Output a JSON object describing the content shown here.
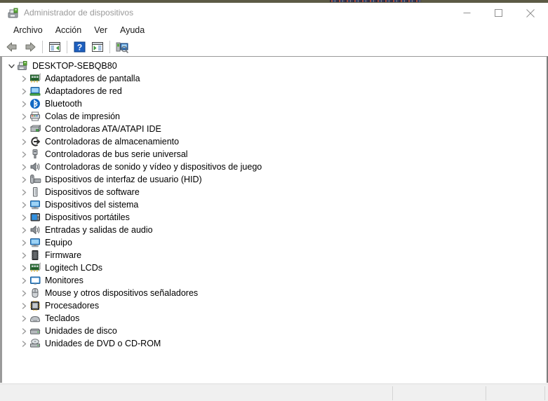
{
  "window": {
    "title": "Administrador de dispositivos",
    "title_icon": "device-manager-icon",
    "controls": {
      "minimize": "minimize-icon",
      "maximize": "maximize-icon",
      "close": "close-icon"
    }
  },
  "menubar": {
    "items": [
      {
        "label": "Archivo"
      },
      {
        "label": "Acción"
      },
      {
        "label": "Ver"
      },
      {
        "label": "Ayuda"
      }
    ]
  },
  "toolbar": {
    "buttons": [
      {
        "name": "back-button",
        "icon": "arrow-left-icon"
      },
      {
        "name": "forward-button",
        "icon": "arrow-right-icon"
      },
      {
        "name": "separator-1",
        "icon": "separator"
      },
      {
        "name": "show-hide-console-tree-button",
        "icon": "console-tree-icon"
      },
      {
        "name": "separator-2",
        "icon": "separator"
      },
      {
        "name": "help-button",
        "icon": "question-mark-icon"
      },
      {
        "name": "properties-button",
        "icon": "properties-icon"
      },
      {
        "name": "separator-3",
        "icon": "separator"
      },
      {
        "name": "scan-hardware-changes-button",
        "icon": "scan-hardware-icon"
      }
    ]
  },
  "tree": {
    "root": {
      "label": "DESKTOP-SEBQB80",
      "icon": "computer-root-icon",
      "expanded": true,
      "twisty": "chevron-down-icon"
    },
    "items": [
      {
        "label": "Adaptadores de pantalla",
        "icon": "display-adapter-icon",
        "twisty": "chevron-right-icon"
      },
      {
        "label": "Adaptadores de red",
        "icon": "network-adapter-icon",
        "twisty": "chevron-right-icon"
      },
      {
        "label": "Bluetooth",
        "icon": "bluetooth-icon",
        "twisty": "chevron-right-icon"
      },
      {
        "label": "Colas de impresión",
        "icon": "printer-icon",
        "twisty": "chevron-right-icon"
      },
      {
        "label": "Controladoras ATA/ATAPI IDE",
        "icon": "ide-controller-icon",
        "twisty": "chevron-right-icon"
      },
      {
        "label": "Controladoras de almacenamiento",
        "icon": "storage-controller-icon",
        "twisty": "chevron-right-icon"
      },
      {
        "label": "Controladoras de bus serie universal",
        "icon": "usb-controller-icon",
        "twisty": "chevron-right-icon"
      },
      {
        "label": "Controladoras de sonido y vídeo y dispositivos de juego",
        "icon": "sound-device-icon",
        "twisty": "chevron-right-icon"
      },
      {
        "label": "Dispositivos de interfaz de usuario (HID)",
        "icon": "hid-device-icon",
        "twisty": "chevron-right-icon"
      },
      {
        "label": "Dispositivos de software",
        "icon": "software-device-icon",
        "twisty": "chevron-right-icon"
      },
      {
        "label": "Dispositivos del sistema",
        "icon": "system-device-icon",
        "twisty": "chevron-right-icon"
      },
      {
        "label": "Dispositivos portátiles",
        "icon": "portable-device-icon",
        "twisty": "chevron-right-icon"
      },
      {
        "label": "Entradas y salidas de audio",
        "icon": "audio-io-icon",
        "twisty": "chevron-right-icon"
      },
      {
        "label": "Equipo",
        "icon": "computer-icon",
        "twisty": "chevron-right-icon"
      },
      {
        "label": "Firmware",
        "icon": "firmware-chip-icon",
        "twisty": "chevron-right-icon"
      },
      {
        "label": "Logitech LCDs",
        "icon": "display-adapter-icon",
        "twisty": "chevron-right-icon"
      },
      {
        "label": "Monitores",
        "icon": "monitor-icon",
        "twisty": "chevron-right-icon"
      },
      {
        "label": "Mouse y otros dispositivos señaladores",
        "icon": "mouse-icon",
        "twisty": "chevron-right-icon"
      },
      {
        "label": "Procesadores",
        "icon": "processor-chip-icon",
        "twisty": "chevron-right-icon"
      },
      {
        "label": "Teclados",
        "icon": "keyboard-icon",
        "twisty": "chevron-right-icon"
      },
      {
        "label": "Unidades de disco",
        "icon": "disk-drive-icon",
        "twisty": "chevron-right-icon"
      },
      {
        "label": "Unidades de DVD o CD-ROM",
        "icon": "dvd-drive-icon",
        "twisty": "chevron-right-icon"
      }
    ]
  },
  "statusbar": {
    "panes": [
      "",
      "",
      ""
    ]
  },
  "colors": {
    "title_text": "#9a9a9a",
    "window_bg": "#ffffff",
    "statusbar_bg": "#f0f0f0",
    "panel_border": "#9a9a9a",
    "accent_blue": "#2a5db0"
  }
}
